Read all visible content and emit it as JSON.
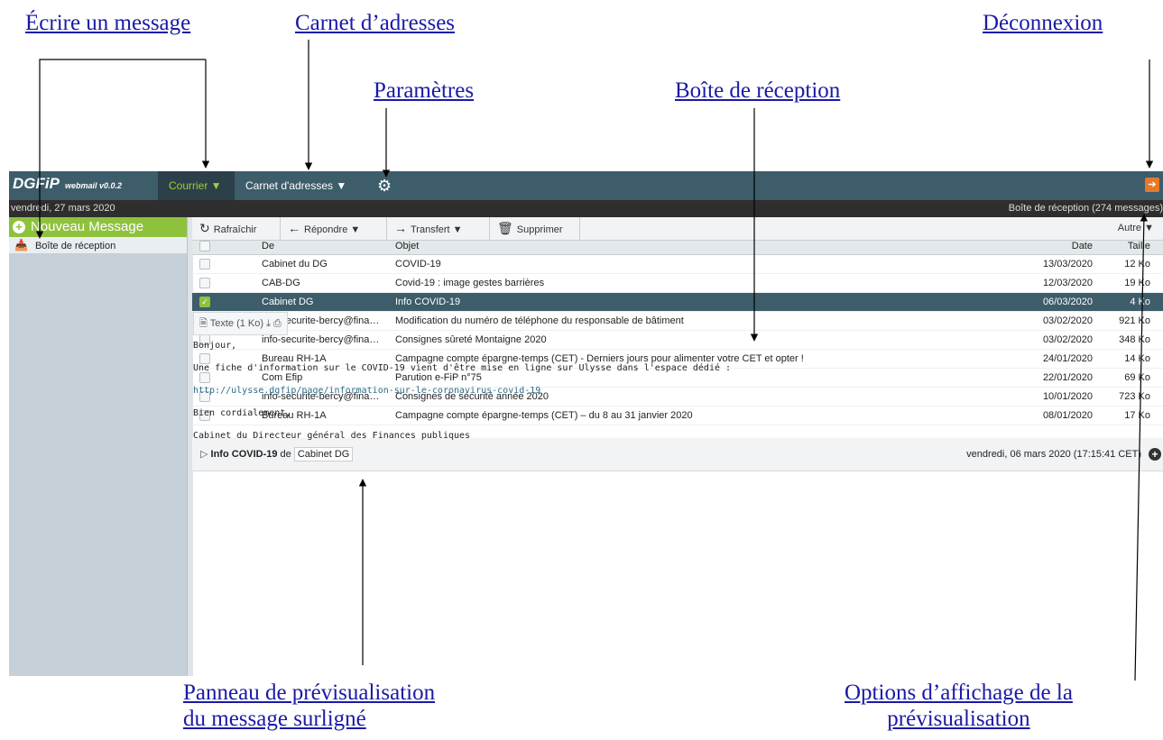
{
  "annotations": {
    "ecrire": "Écrire un message",
    "carnet": "Carnet d’adresses ",
    "deconnexion": "Déconnexion",
    "parametres": "Paramètres ",
    "boite": "Boîte de réception",
    "panneau_line1": "Panneau de prévisualisation",
    "panneau_line2": "du message surligné",
    "options_line1": " Options d’affichage de la",
    "options_line2": "prévisualisation"
  },
  "app": {
    "logo": "DGFiP",
    "logo_sub": "webmail v0.0.2",
    "menu_courrier": "Courrier ▼",
    "menu_carnet": "Carnet d'adresses ▼",
    "date": "vendredi, 27 mars 2020",
    "inbox_status": "Boîte de réception (274 messages)"
  },
  "sidebar": {
    "new_message": "Nouveau Message",
    "inbox": "Boîte de réception"
  },
  "toolbar": {
    "refresh": "Rafraîchir",
    "reply": "Répondre ▼",
    "forward": "Transfert ▼",
    "delete": "Supprimer",
    "other": "Autre ▼"
  },
  "columns": {
    "from": "De",
    "subject": "Objet",
    "date": "Date",
    "size": "Taille"
  },
  "messages": [
    {
      "from": "Cabinet du DG",
      "subject": "COVID-19",
      "date": "13/03/2020",
      "size": "12 Ko",
      "selected": false
    },
    {
      "from": "CAB-DG",
      "subject": "Covid-19 : image gestes barrières",
      "date": "12/03/2020",
      "size": "19 Ko",
      "selected": false
    },
    {
      "from": "Cabinet DG",
      "subject": "Info COVID-19",
      "date": "06/03/2020",
      "size": "4 Ko",
      "selected": true
    },
    {
      "from": "info-securite-bercy@fina…",
      "subject": "Modification du numéro de téléphone du responsable de bâtiment",
      "date": "03/02/2020",
      "size": "921 Ko",
      "selected": false
    },
    {
      "from": "info-securite-bercy@fina…",
      "subject": "Consignes sûreté Montaigne 2020",
      "date": "03/02/2020",
      "size": "348 Ko",
      "selected": false
    },
    {
      "from": "Bureau RH-1A",
      "subject": "Campagne compte épargne-temps (CET) - Derniers jours pour alimenter votre CET et opter !",
      "date": "24/01/2020",
      "size": "14 Ko",
      "selected": false
    },
    {
      "from": "Com Efip",
      "subject": "Parution e-FiP n°75",
      "date": "22/01/2020",
      "size": "69 Ko",
      "selected": false
    },
    {
      "from": "info-securite-bercy@fina…",
      "subject": "Consignes de sécurité année 2020",
      "date": "10/01/2020",
      "size": "723 Ko",
      "selected": false
    },
    {
      "from": "Bureau RH-1A",
      "subject": "Campagne compte épargne-temps (CET) – du 8 au 31 janvier 2020",
      "date": "08/01/2020",
      "size": "17 Ko",
      "selected": false
    }
  ],
  "preview": {
    "subject": "Info COVID-19",
    "from_label": "de",
    "sender": "Cabinet DG",
    "date": "vendredi, 06 mars 2020 (17:15:41 CET)",
    "attachment": "Texte (1 Ko)",
    "body": {
      "greeting": "Bonjour,",
      "line1": "Une fiche d'information sur le COVID-19 vient d'être mise en ligne sur Ulysse dans l'espace dédié :",
      "link": "http://ulysse.dgfip/page/information-sur-le-coronavirus-covid-19",
      "closing": "Bien cordialement,",
      "signature": "Cabinet du Directeur général des Finances publiques"
    }
  }
}
